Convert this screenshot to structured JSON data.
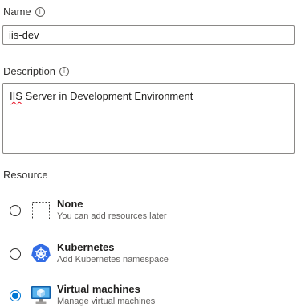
{
  "name_field": {
    "label": "Name",
    "info_icon": "info-icon",
    "value": "iis-dev"
  },
  "description_field": {
    "label": "Description",
    "info_icon": "info-icon",
    "value_misspelled_part": "IIS",
    "value_rest": " Server in Development Environment"
  },
  "resource": {
    "label": "Resource",
    "options": [
      {
        "title": "None",
        "subtitle": "You can add resources later",
        "icon": "dashed-box-icon",
        "selected": false
      },
      {
        "title": "Kubernetes",
        "subtitle": "Add Kubernetes namespace",
        "icon": "kubernetes-icon",
        "selected": false
      },
      {
        "title": "Virtual machines",
        "subtitle": "Manage virtual machines",
        "icon": "virtual-machine-icon",
        "selected": true
      }
    ]
  },
  "colors": {
    "accent": "#0078d4",
    "spellcheck": "#e81123"
  }
}
